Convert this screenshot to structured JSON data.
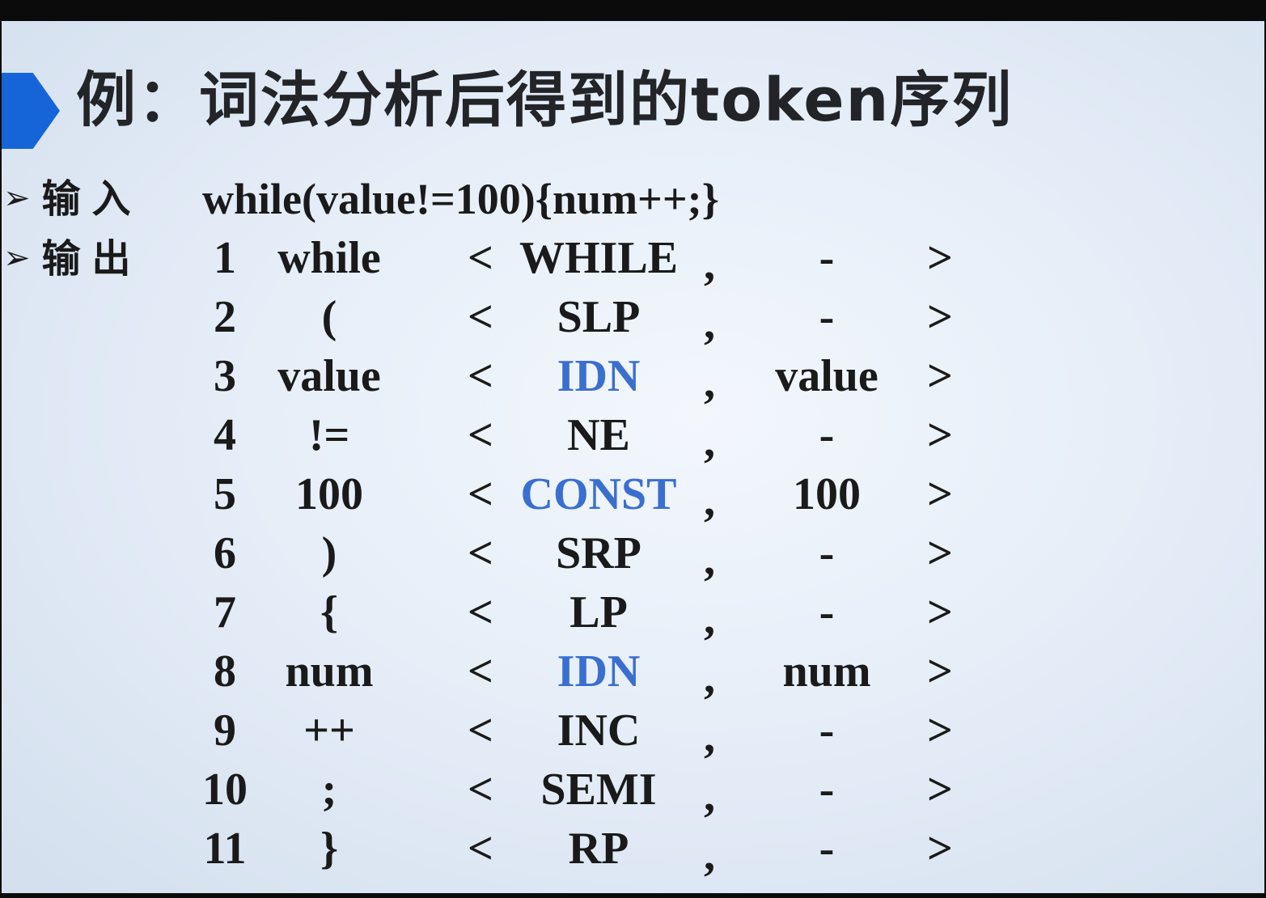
{
  "slide": {
    "title": "例：词法分析后得到的token序列",
    "accent_color": "#1565d8",
    "highlight_color": "#3a6fd0",
    "input_label": "输入",
    "output_label": "输出",
    "bullet_icon": "arrow-right-icon",
    "input_code": "while(value!=100){num++;}"
  },
  "tokens": [
    {
      "num": "1",
      "lexeme": "while",
      "type": "WHILE",
      "attr": "-",
      "highlight": false
    },
    {
      "num": "2",
      "lexeme": "(",
      "type": "SLP",
      "attr": "-",
      "highlight": false
    },
    {
      "num": "3",
      "lexeme": "value",
      "type": "IDN",
      "attr": "value",
      "highlight": true
    },
    {
      "num": "4",
      "lexeme": "!=",
      "type": "NE",
      "attr": "-",
      "highlight": false
    },
    {
      "num": "5",
      "lexeme": "100",
      "type": "CONST",
      "attr": "100",
      "highlight": true
    },
    {
      "num": "6",
      "lexeme": ")",
      "type": "SRP",
      "attr": "-",
      "highlight": false
    },
    {
      "num": "7",
      "lexeme": "{",
      "type": "LP",
      "attr": "-",
      "highlight": false
    },
    {
      "num": "8",
      "lexeme": "num",
      "type": "IDN",
      "attr": "num",
      "highlight": true
    },
    {
      "num": "9",
      "lexeme": "++",
      "type": "INC",
      "attr": "-",
      "highlight": false
    },
    {
      "num": "10",
      "lexeme": ";",
      "type": "SEMI",
      "attr": "-",
      "highlight": false
    },
    {
      "num": "11",
      "lexeme": "}",
      "type": "RP",
      "attr": "-",
      "highlight": false
    }
  ],
  "punct": {
    "lt": "<",
    "comma": ",",
    "gt": ">"
  }
}
